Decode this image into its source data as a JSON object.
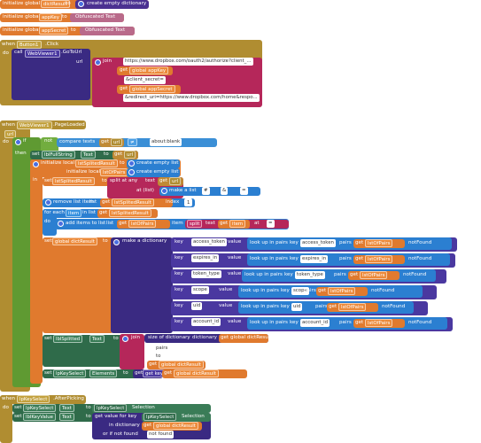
{
  "globals": [
    {
      "kw": "initialize global",
      "name": "dictResult",
      "to": "to",
      "value": "create empty dictionary"
    },
    {
      "kw": "initialize global",
      "name": "appKey",
      "to": "to",
      "value": "Obfuscated Text"
    },
    {
      "kw": "initialize global",
      "name": "appSecret",
      "to": "to",
      "value": "Obfuscated Text"
    }
  ],
  "button_click": {
    "when": "when",
    "component": "Button1",
    "event": ".Click",
    "do": "do",
    "call": "call",
    "viewer": "WebViewer1",
    "method": ".GoToUrl",
    "url": "url",
    "join": "join",
    "parts": [
      "https://www.dropbox.com/oauth2/authorize?client_...",
      "get",
      "global appKey",
      "&client_secret=",
      "get",
      "global appSecret",
      "&redirect_uri=https://www.dropbox.com/home&respo..."
    ]
  },
  "page_loaded": {
    "when": "when",
    "component": "WebViewer1",
    "event": ".PageLoaded",
    "param": "url",
    "do": "do",
    "if": "if",
    "not": "not",
    "compare": "compare texts",
    "get": "get",
    "url": "url",
    "op": "≠",
    "about": "about:blank",
    "then": "then",
    "set": "set",
    "lbl": "lblFullString",
    "text": "Text",
    "to": "to",
    "init_local": "initialize local",
    "lstSplited": "lstSplitedResult",
    "to2": "to",
    "empty_list": "create empty list",
    "lstOfPairs": "lstOfPairs",
    "in": "in",
    "split_at_any": "split at any",
    "text_kw": "text",
    "at_list": "at (list)",
    "make_list": "make a list",
    "sep1": "#",
    "sep2": "&",
    "sep3": "=",
    "remove": "remove list item",
    "list": "list",
    "global_lst": "lstSplitedResult",
    "index": "index",
    "index_val": "1",
    "for_each": "for each",
    "item": "item",
    "in_list": "in list",
    "add_items": "add items to list",
    "list_kw": "list",
    "item_kw": "item",
    "split": "split",
    "text2": "text",
    "at": "at",
    "sp": " ",
    "set_global": "set",
    "dict_name": "global dictResult",
    "to3": "to",
    "make_dict": "make a dictionary",
    "key": "key",
    "value": "value",
    "lookup": "look up in pairs",
    "key2": "key",
    "pairs": "pairs",
    "notfound": "notFound",
    "entries": [
      {
        "key": "access_token"
      },
      {
        "key": "expires_in"
      },
      {
        "key": "token_type"
      },
      {
        "key": "scope"
      },
      {
        "key": "uid"
      },
      {
        "key": "account_id"
      }
    ],
    "set_lblSplitted": "lblSplitted",
    "join": "join",
    "size_dict": "size of dictionary",
    "dictionary": "dictionary",
    "pairs_txt": "pairs",
    "to_txt": "to",
    "lpk": "lpKeySelect",
    "elements": "Elements",
    "get_keys": "get keys"
  },
  "after_picking": {
    "when": "when",
    "component": "lpKeySelect",
    "event": ".AfterPicking",
    "do": "do",
    "set": "set",
    "lpk": "lpKeySelect",
    "text": "Text",
    "to": "to",
    "selection": "Selection",
    "lblKeyValue": "lblKeyValue",
    "get_value": "get value for key",
    "in_dict": "in dictionary",
    "or_if": "or if not found",
    "not_found": "not found",
    "get": "get",
    "global_dict": "global dictResult"
  }
}
